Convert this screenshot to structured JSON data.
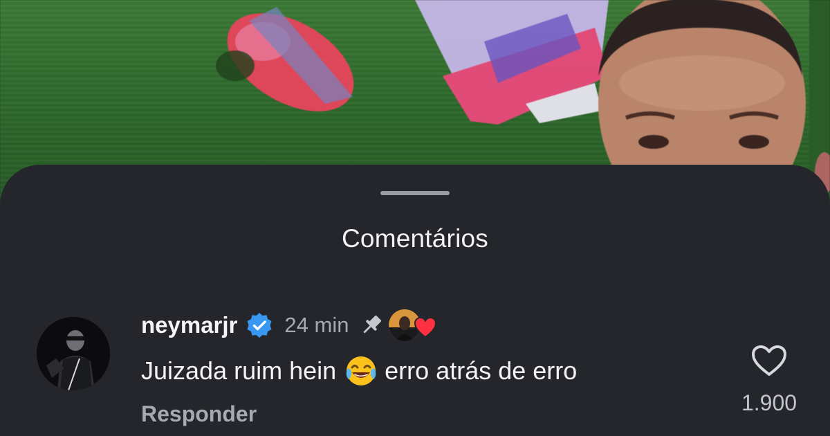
{
  "sheet": {
    "title": "Comentários"
  },
  "comment": {
    "username": "neymarjr",
    "verified_icon": "verified-badge-icon",
    "time": "24 min",
    "pinned_icon": "pin-icon",
    "liked_by_creator_icon": "heart-icon",
    "text_before_emoji": "Juizada ruim hein",
    "emoji": "face-with-tears-of-joy",
    "text_after_emoji": "erro atrás de erro",
    "reply_label": "Responder",
    "like_count": "1.900"
  },
  "colors": {
    "sheet_background": "#25262b",
    "verified_blue": "#3897f0",
    "heart_red": "#ff3040",
    "secondary_text": "#a7a9b0"
  }
}
